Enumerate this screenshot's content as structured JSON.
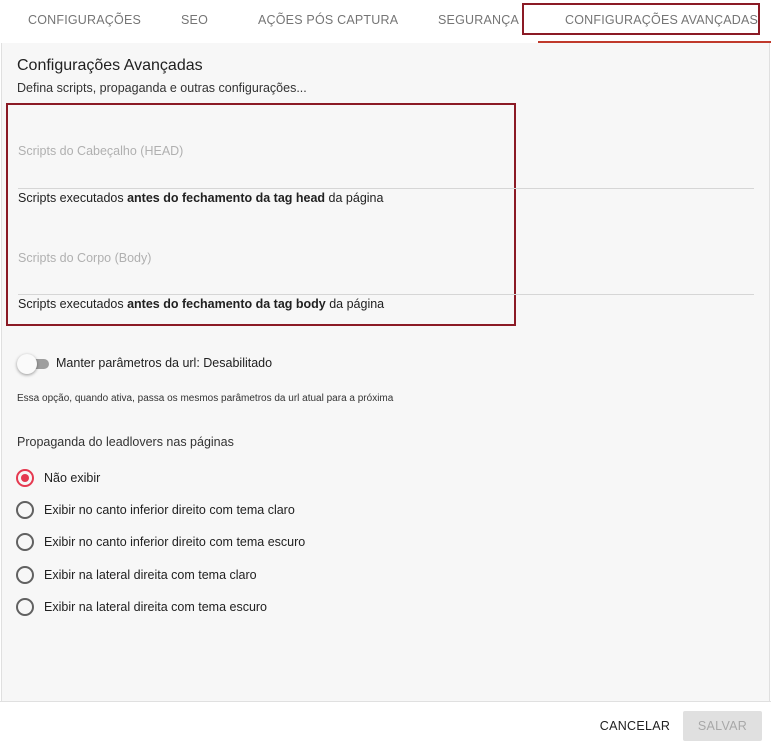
{
  "tabs": [
    {
      "label": "CONFIGURAÇÕES"
    },
    {
      "label": "SEO"
    },
    {
      "label": "AÇÕES PÓS CAPTURA"
    },
    {
      "label": "SEGURANÇA"
    },
    {
      "label": "CONFIGURAÇÕES AVANÇADAS",
      "active": true
    }
  ],
  "section": {
    "title": "Configurações Avançadas",
    "subtitle": "Defina scripts, propaganda e outras configurações..."
  },
  "head_scripts": {
    "placeholder": "Scripts do Cabeçalho (HEAD)",
    "value": "",
    "helper_prefix": "Scripts executados ",
    "helper_bold": "antes do fechamento da tag head",
    "helper_suffix": " da página"
  },
  "body_scripts": {
    "placeholder": "Scripts do Corpo (Body)",
    "value": "",
    "helper_prefix": "Scripts executados ",
    "helper_bold": "antes do fechamento da tag body",
    "helper_suffix": " da página"
  },
  "url_params": {
    "label": "Manter parâmetros da url: Desabilitado",
    "enabled": false,
    "description": "Essa opção, quando ativa, passa os mesmos parâmetros da url atual para a próxima"
  },
  "propaganda": {
    "title": "Propaganda do leadlovers nas páginas",
    "options": [
      {
        "label": "Não exibir",
        "selected": true
      },
      {
        "label": "Exibir no canto inferior direito com tema claro",
        "selected": false
      },
      {
        "label": "Exibir no canto inferior direito com tema escuro",
        "selected": false
      },
      {
        "label": "Exibir na lateral direita com tema claro",
        "selected": false
      },
      {
        "label": "Exibir na lateral direita com tema escuro",
        "selected": false
      }
    ]
  },
  "footer": {
    "cancel_label": "CANCELAR",
    "save_label": "SALVAR"
  },
  "colors": {
    "accent": "#e53950",
    "highlight_border": "#8b1a25",
    "disabled_button": "#e0e0e0"
  }
}
